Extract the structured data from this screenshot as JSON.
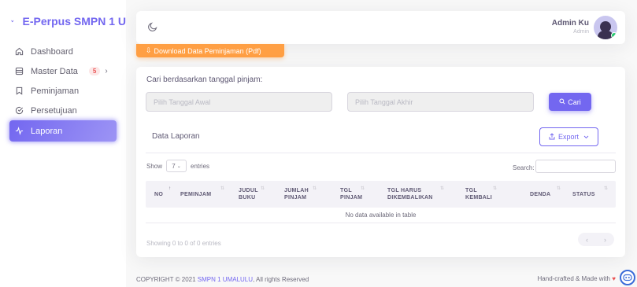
{
  "brand": {
    "name": "E-Perpus SMPN 1 U"
  },
  "sidebar": {
    "items": [
      {
        "label": "Dashboard",
        "icon": "home-icon"
      },
      {
        "label": "Master Data",
        "icon": "database-icon",
        "badge": "5"
      },
      {
        "label": "Peminjaman",
        "icon": "bookmark-icon"
      },
      {
        "label": "Persetujuan",
        "icon": "check-circle-icon"
      },
      {
        "label": "Laporan",
        "icon": "activity-icon",
        "active": true
      }
    ]
  },
  "navbar": {
    "user_name": "Admin Ku",
    "user_role": "Admin"
  },
  "download_button": "Download Data Peminjaman (Pdf)",
  "filter": {
    "title": "Cari berdasarkan tanggal pinjam:",
    "start_placeholder": "Pilih Tanggal Awal",
    "end_placeholder": "Pilih Tanggal Akhir",
    "search_button": "Cari"
  },
  "report": {
    "title": "Data Laporan",
    "export_label": "Export",
    "show_label": "Show",
    "entries_value": "7",
    "entries_label": "entries",
    "search_label": "Search:",
    "columns": [
      "NO",
      "PEMINJAM",
      "JUDUL BUKU",
      "JUMLAH PINJAM",
      "TGL PINJAM",
      "TGL HARUS DIKEMBALIKAN",
      "TGL KEMBALI",
      "DENDA",
      "STATUS"
    ],
    "empty_message": "No data available in table",
    "info": "Showing 0 to 0 of 0 entries"
  },
  "footer": {
    "copyright_prefix": "COPYRIGHT © 2021",
    "copyright_link": "SMPN 1 UMALULU",
    "copyright_suffix": ", All rights Reserved",
    "right_text": "Hand-crafted & Made with"
  },
  "colors": {
    "primary": "#7367f0",
    "warning": "#ff9f43",
    "danger": "#ea5455",
    "success": "#28c76f"
  }
}
